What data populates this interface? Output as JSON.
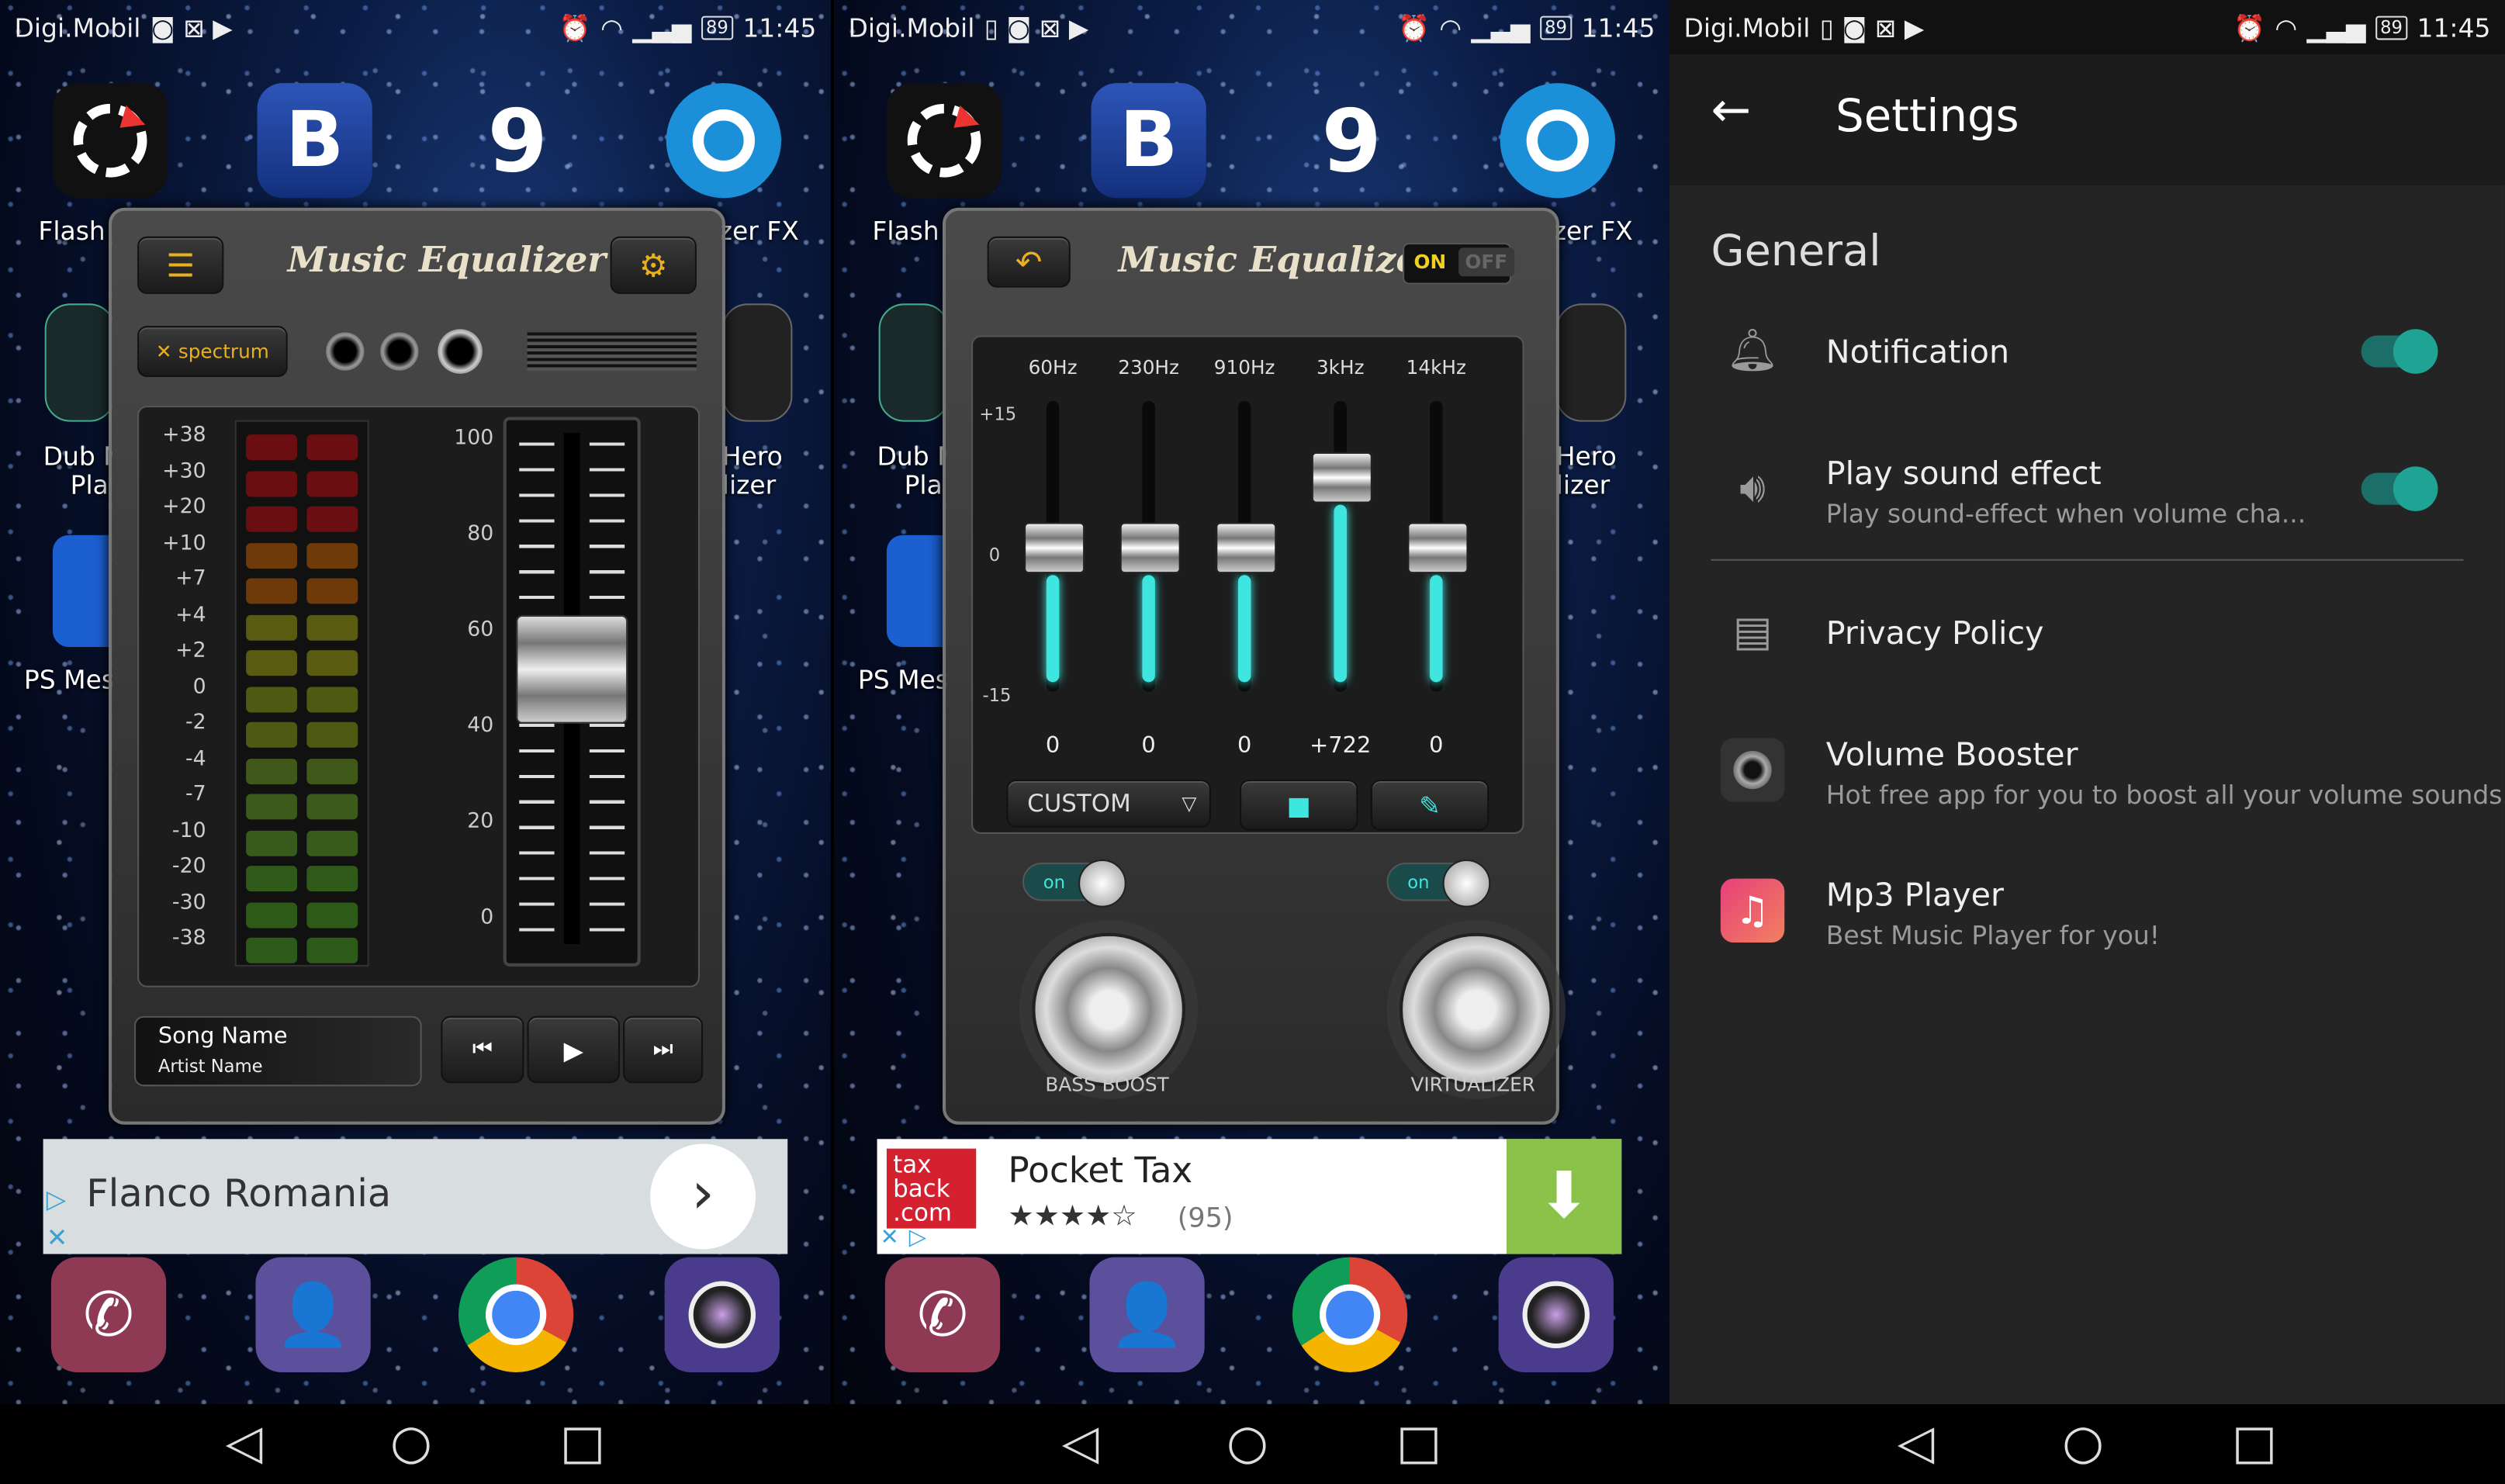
{
  "status": {
    "carrier": "Digi.Mobil",
    "battery": "89",
    "time": "11:45"
  },
  "home": {
    "labels": {
      "flash": "Flash",
      "fx": "zer FX",
      "dub1": "Dub N",
      "dub2": "Pla",
      "hero1": "Hero",
      "hero2": "lizer",
      "psmes": "PS Mes"
    },
    "icon_b": "B",
    "icon_9": "9"
  },
  "eq1": {
    "title": "Music Equalizer",
    "spectrum": "spectrum",
    "db_labels": [
      "+38",
      "+30",
      "+20",
      "+10",
      "+7",
      "+4",
      "+2",
      "0",
      "-2",
      "-4",
      "-7",
      "-10",
      "-20",
      "-30",
      "-38"
    ],
    "slider_labels": [
      "100",
      "80",
      "60",
      "40",
      "20",
      "0"
    ],
    "volume_level_percent": 60,
    "song_name": "Song Name",
    "artist_name": "Artist Name"
  },
  "ad1": {
    "title": "Flanco Romania"
  },
  "eq2": {
    "title": "Music Equalizer",
    "on": "ON",
    "off": "OFF",
    "scale_top": "+15",
    "scale_mid": "0",
    "scale_bottom": "-15",
    "bands": [
      {
        "freq": "60Hz",
        "value": "0",
        "level": 0
      },
      {
        "freq": "230Hz",
        "value": "0",
        "level": 0
      },
      {
        "freq": "910Hz",
        "value": "0",
        "level": 0
      },
      {
        "freq": "3kHz",
        "value": "+722",
        "level": 7.2
      },
      {
        "freq": "14kHz",
        "value": "0",
        "level": 0
      }
    ],
    "preset": "CUSTOM",
    "toggle_on": "on",
    "bass_boost": "BASS BOOST",
    "virtualizer": "VIRTUALIZER"
  },
  "ad2": {
    "title": "Pocket Tax",
    "rating_count": "(95)",
    "logo1": "tax",
    "logo2": "back",
    "logo3": ".com",
    "stars": "★★★★☆"
  },
  "settings": {
    "title": "Settings",
    "section": "General",
    "items": [
      {
        "title": "Notification",
        "subtitle": ""
      },
      {
        "title": "Play sound effect",
        "subtitle": "Play sound-effect when volume cha..."
      },
      {
        "title": "Privacy Policy",
        "subtitle": ""
      },
      {
        "title": "Volume Booster",
        "subtitle": "Hot free app for you to boost all your volume sounds."
      },
      {
        "title": "Mp3 Player",
        "subtitle": "Best Music Player for you!"
      }
    ]
  },
  "colors": {
    "accent": "#3fe6e0",
    "toggle_on": "#1ea394",
    "eq_gold": "#e8b020"
  }
}
